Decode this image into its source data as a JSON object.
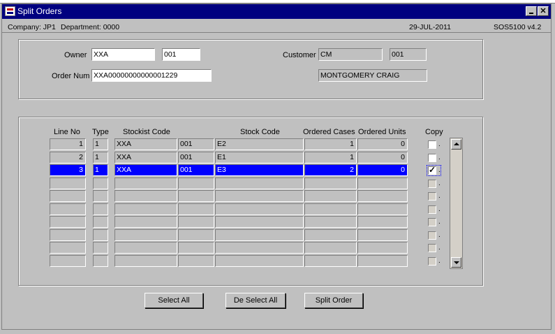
{
  "window": {
    "title": "Split Orders"
  },
  "infobar": {
    "company": "Company:  JP1",
    "department": "Department:  0000",
    "date": "29-JUL-2011",
    "version": "SOS5100  v4.2"
  },
  "header": {
    "owner_label": "Owner",
    "owner_value": "XXA",
    "owner_code": "001",
    "order_num_label": "Order Num",
    "order_num_value": "XXA00000000000001229",
    "customer_label": "Customer",
    "customer_value": "CM",
    "customer_code": "001",
    "customer_name": "MONTGOMERY CRAIG"
  },
  "table": {
    "headers": {
      "line_no": "Line No",
      "type": "Type",
      "stockist_code": "Stockist Code",
      "stock_code": "Stock Code",
      "ordered_cases": "Ordered Cases",
      "ordered_units": "Ordered Units",
      "copy": "Copy"
    },
    "rows": [
      {
        "line_no": "1",
        "type": "1",
        "stockist": "XXA",
        "stockist_num": "001",
        "stock_code": "E2",
        "cases": "1",
        "units": "0",
        "copy": false
      },
      {
        "line_no": "2",
        "type": "1",
        "stockist": "XXA",
        "stockist_num": "001",
        "stock_code": "E1",
        "cases": "1",
        "units": "0",
        "copy": false
      },
      {
        "line_no": "3",
        "type": "1",
        "stockist": "XXA",
        "stockist_num": "001",
        "stock_code": "E3",
        "cases": "2",
        "units": "0",
        "copy": true
      }
    ],
    "selected_row": 2,
    "empty_rows": 7
  },
  "buttons": {
    "select_all": "Select All",
    "deselect_all": "De Select All",
    "split_order": "Split Order"
  }
}
